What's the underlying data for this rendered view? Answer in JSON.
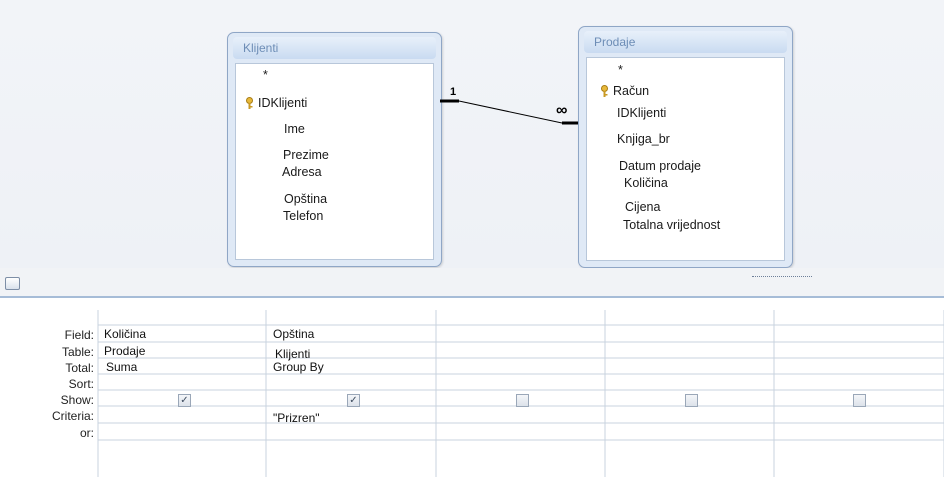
{
  "tables": [
    {
      "title": "Klijenti",
      "fields": [
        "*",
        "IDKlijenti",
        "Ime",
        "Prezime",
        "Adresa",
        "Opština",
        "Telefon"
      ],
      "key_field": "IDKlijenti"
    },
    {
      "title": "Prodaje",
      "fields": [
        "*",
        "Račun",
        "IDKlijenti",
        "Knjiga_br",
        "Datum prodaje",
        "Količina",
        "Cijena",
        "Totalna vrijednost"
      ],
      "key_field": "Račun"
    }
  ],
  "relationship": {
    "one_label": "1",
    "many_label": "∞"
  },
  "grid": {
    "row_labels": [
      "Field:",
      "Table:",
      "Total:",
      "Sort:",
      "Show:",
      "Criteria:",
      "or:"
    ],
    "columns": [
      {
        "field": "Količina",
        "table": "Prodaje",
        "total": "Suma",
        "sort": "",
        "show": true,
        "criteria": "",
        "or": ""
      },
      {
        "field": "Opština",
        "table": "Klijenti",
        "total": "Group By",
        "sort": "",
        "show": true,
        "criteria": "\"Prizren\"",
        "or": ""
      },
      {
        "field": "",
        "table": "",
        "total": "",
        "sort": "",
        "show": false,
        "criteria": "",
        "or": ""
      },
      {
        "field": "",
        "table": "",
        "total": "",
        "sort": "",
        "show": false,
        "criteria": "",
        "or": ""
      },
      {
        "field": "",
        "table": "",
        "total": "",
        "sort": "",
        "show": false,
        "criteria": "",
        "or": ""
      }
    ]
  },
  "icons": {
    "key": "key-icon",
    "check": "check-icon",
    "pane": "pane-toggle-icon"
  },
  "colors": {
    "title_text": "#6d8db6",
    "grid_line": "#c9d3df",
    "splitter": "#a6bcd7"
  }
}
